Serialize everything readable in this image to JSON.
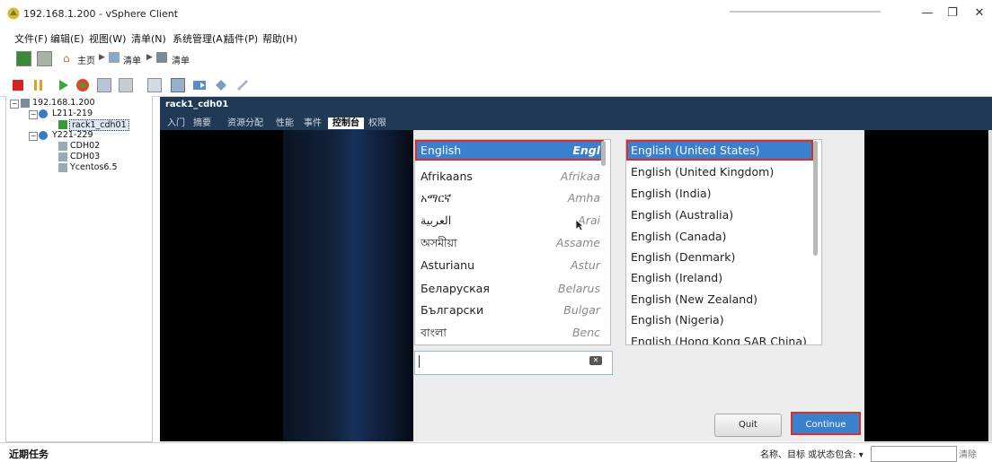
{
  "window": {
    "title": "192.168.1.200 - vSphere Client"
  },
  "menu": [
    "文件(F)",
    "编辑(E)",
    "视图(W)",
    "清单(N)",
    "系统管理(A)",
    "插件(P)",
    "帮助(H)"
  ],
  "nav": {
    "home": "主页",
    "inventory1": "清单",
    "inventory2": "清单"
  },
  "tree": {
    "host": "192.168.1.200",
    "cluster1": "L211-219",
    "vm_selected": "rack1_cdh01",
    "cluster2": "Y221-229",
    "vms": [
      "CDH02",
      "CDH03",
      "Ycentos6.5"
    ]
  },
  "panel": {
    "title": "rack1_cdh01",
    "tabs": [
      "入门",
      "摘要",
      "资源分配",
      "性能",
      "事件",
      "控制台",
      "权限"
    ],
    "active_tab": "控制台"
  },
  "installer": {
    "languages": [
      {
        "native": "English",
        "english": "Engl"
      },
      {
        "native": "Afrikaans",
        "english": "Afrikaa"
      },
      {
        "native": "አማርኛ",
        "english": "Amha"
      },
      {
        "native": "العربية",
        "english": "Arai"
      },
      {
        "native": "অসমীয়া",
        "english": "Assame"
      },
      {
        "native": "Asturianu",
        "english": "Astur"
      },
      {
        "native": "Беларуская",
        "english": "Belarus"
      },
      {
        "native": "Български",
        "english": "Bulgar"
      },
      {
        "native": "বাংলা",
        "english": "Benc"
      }
    ],
    "search_value": "",
    "locales": [
      "English (United States)",
      "English (United Kingdom)",
      "English (India)",
      "English (Australia)",
      "English (Canada)",
      "English (Denmark)",
      "English (Ireland)",
      "English (New Zealand)",
      "English (Nigeria)",
      "English (Hong Kong SAR China)"
    ],
    "quit_label": "Quit",
    "continue_label": "Continue"
  },
  "status": {
    "recent_tasks": "近期任务",
    "filter_label": "名称、目标 或状态包含: ▾",
    "clear": "清除"
  },
  "colors": {
    "selection_blue": "#3b80cc",
    "highlight_red": "#d9302c",
    "header_navy": "#203a56"
  }
}
